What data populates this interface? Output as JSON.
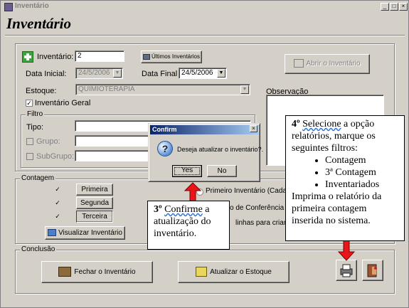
{
  "window": {
    "title": "Inventário",
    "min": "_",
    "max": "□",
    "close": "×"
  },
  "heading": "Inventário",
  "form": {
    "inventario_label": "Inventário:",
    "inventario_value": "2",
    "ultimos_button": "Últimos Inventários",
    "abrir_button": "Abrir o Inventário",
    "data_inicial_label": "Data Inicial:",
    "data_inicial_value": "24/5/2006",
    "data_final_label": "Data Final",
    "data_final_value": "24/5/2006",
    "estoque_label": "Estoque:",
    "estoque_value": "QUIMIOTERAPIA",
    "inventario_geral_label": "Inventário Geral",
    "observacao_label": "Observação"
  },
  "filtro": {
    "label": "Filtro",
    "tipo_label": "Tipo:",
    "grupo_label": "Grupo:",
    "subgrupo_label": "SubGrupo:"
  },
  "contagem": {
    "label": "Contagem",
    "buttons": [
      "Primeira",
      "Segunda",
      "Terceira"
    ],
    "visualizar_button": "Visualizar Inventário"
  },
  "options": {
    "primeiro": "Primeiro Inventário (Cadast",
    "conferencia": "o de Conferência (",
    "linhas": "linhas para criar"
  },
  "conclusao": {
    "label": "Conclusão",
    "fechar_button": "Fechar o Inventário",
    "atualizar_button": "Atualizar o Estoque"
  },
  "dialog": {
    "title": "Confirm",
    "message": "Deseja atualizar o inventário?.",
    "yes": "Yes",
    "no": "No"
  },
  "callout3": {
    "step": "3º",
    "word": "Confirme",
    "rest": " a atualização do inventário."
  },
  "callout4": {
    "step": "4º",
    "word": "Selecione",
    "rest": " a opção relatórios, marque os seguintes filtros:",
    "items": [
      "Contagem",
      "3ª Contagem",
      "Inventariados"
    ],
    "footer": "Imprima o relatório da primeira contagem inserida no sistema."
  },
  "colors": {
    "arrow": "#e8161b",
    "accent": "#0a246a"
  }
}
